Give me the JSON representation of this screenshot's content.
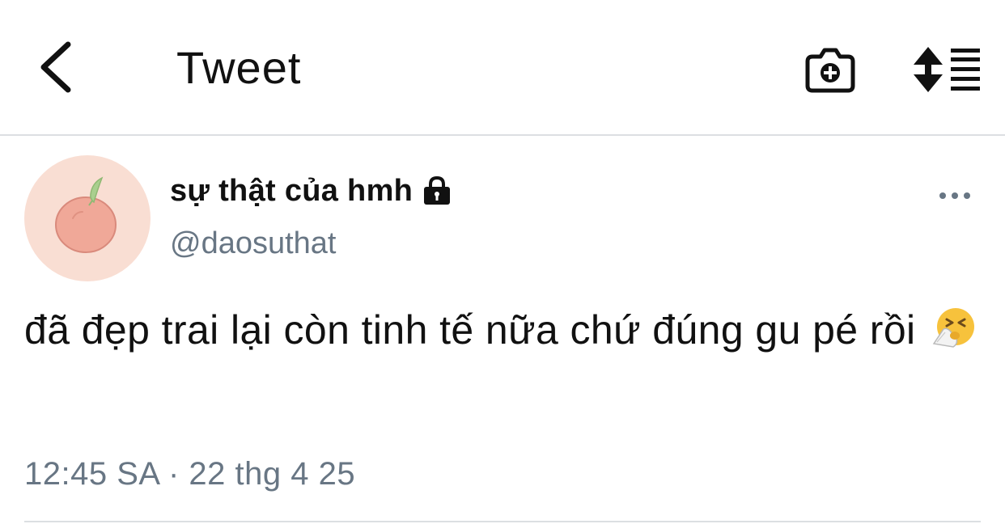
{
  "header": {
    "title": "Tweet",
    "back_icon": "chevron-left-icon",
    "camera_icon": "camera-add-icon",
    "sort_icon": "sort-list-icon"
  },
  "tweet": {
    "display_name": "sự thật của hmh",
    "protected_icon": "lock-icon",
    "handle": "@daosuthat",
    "avatar_icon": "peach-icon",
    "text": "đã đẹp trai lại còn tinh tế nữa chứ đúng gu pé rồi",
    "emoji": "sneezing-face-emoji",
    "timestamp": "12:45 SA · 22 thg 4 25",
    "more_icon": "more-dots-icon"
  },
  "colors": {
    "text_primary": "#111111",
    "text_secondary": "#687684",
    "divider": "#dcdfe2",
    "avatar_bg": "#f9ded3",
    "peach": "#f0a898",
    "leaf": "#a9cf8e"
  }
}
